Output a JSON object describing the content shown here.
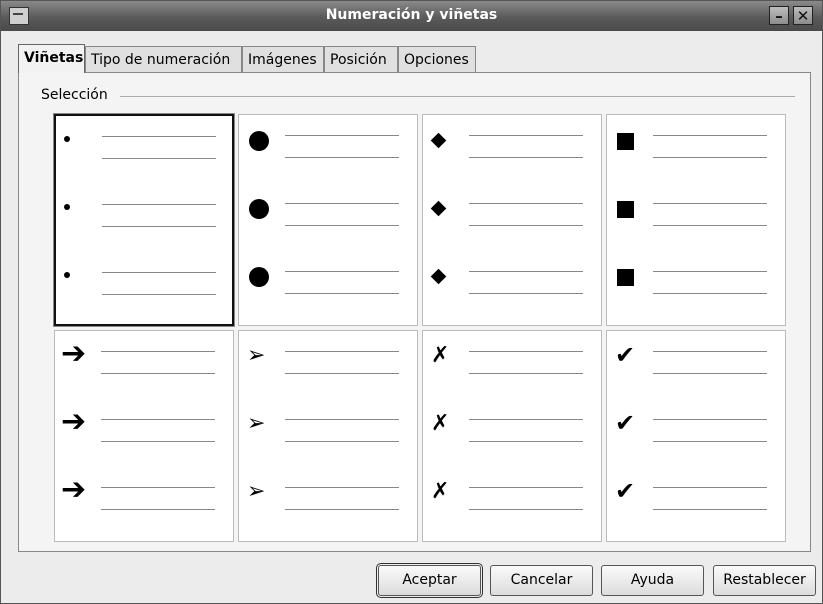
{
  "window": {
    "title": "Numeración y viñetas"
  },
  "tabs": [
    {
      "label": "Viñetas"
    },
    {
      "label": "Tipo de numeración"
    },
    {
      "label": "Imágenes"
    },
    {
      "label": "Posición"
    },
    {
      "label": "Opciones"
    }
  ],
  "section": {
    "label": "Selección"
  },
  "bullets": [
    {
      "icon": "small-dot-icon",
      "glyph": ""
    },
    {
      "icon": "large-dot-icon",
      "glyph": ""
    },
    {
      "icon": "diamond-icon",
      "glyph": ""
    },
    {
      "icon": "square-icon",
      "glyph": ""
    },
    {
      "icon": "bold-arrow-icon",
      "glyph": "➔"
    },
    {
      "icon": "outline-arrowhead-icon",
      "glyph": "➢"
    },
    {
      "icon": "x-mark-icon",
      "glyph": "✗"
    },
    {
      "icon": "check-mark-icon",
      "glyph": "✔"
    }
  ],
  "buttons": {
    "accept": "Aceptar",
    "cancel": "Cancelar",
    "help": "Ayuda",
    "reset": "Restablecer"
  }
}
